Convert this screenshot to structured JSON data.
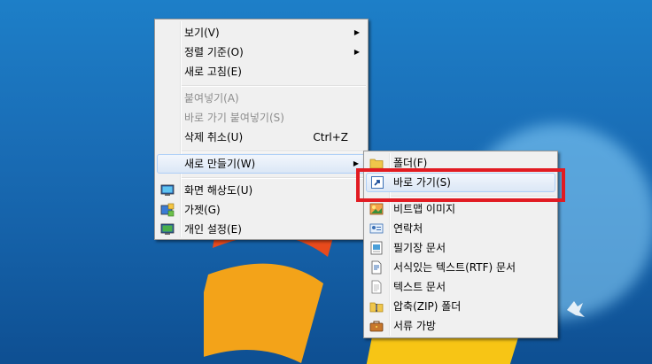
{
  "context_menu": {
    "items": [
      {
        "label": "보기(V)",
        "has_submenu": true
      },
      {
        "label": "정렬 기준(O)",
        "has_submenu": true
      },
      {
        "label": "새로 고침(E)"
      },
      {
        "label": "붙여넣기(A)",
        "disabled": true
      },
      {
        "label": "바로 가기 붙여넣기(S)",
        "disabled": true
      },
      {
        "label": "삭제 취소(U)",
        "shortcut": "Ctrl+Z"
      },
      {
        "label": "새로 만들기(W)",
        "has_submenu": true,
        "highlighted": true
      },
      {
        "label": "화면 해상도(U)",
        "icon": "display-resolution-icon"
      },
      {
        "label": "가젯(G)",
        "icon": "gadgets-icon"
      },
      {
        "label": "개인 설정(E)",
        "icon": "personalize-icon"
      }
    ]
  },
  "new_submenu": {
    "items": [
      {
        "label": "폴더(F)",
        "icon": "folder-icon"
      },
      {
        "label": "바로 가기(S)",
        "icon": "shortcut-icon",
        "highlighted": true
      },
      {
        "label": "비트맵 이미지",
        "icon": "bitmap-icon"
      },
      {
        "label": "연락처",
        "icon": "contact-icon"
      },
      {
        "label": "필기장 문서",
        "icon": "journal-icon"
      },
      {
        "label": "서식있는 텍스트(RTF) 문서",
        "icon": "rtf-document-icon"
      },
      {
        "label": "텍스트 문서",
        "icon": "text-document-icon"
      },
      {
        "label": "압축(ZIP) 폴더",
        "icon": "zip-folder-icon"
      },
      {
        "label": "서류 가방",
        "icon": "briefcase-icon"
      }
    ]
  },
  "colors": {
    "desktop_blue": "#1a6fb8",
    "menu_bg": "#f0f0f0",
    "highlight_border": "#aecff7",
    "annotation_red": "#e11b22",
    "disabled_text": "#8d8d8d"
  }
}
